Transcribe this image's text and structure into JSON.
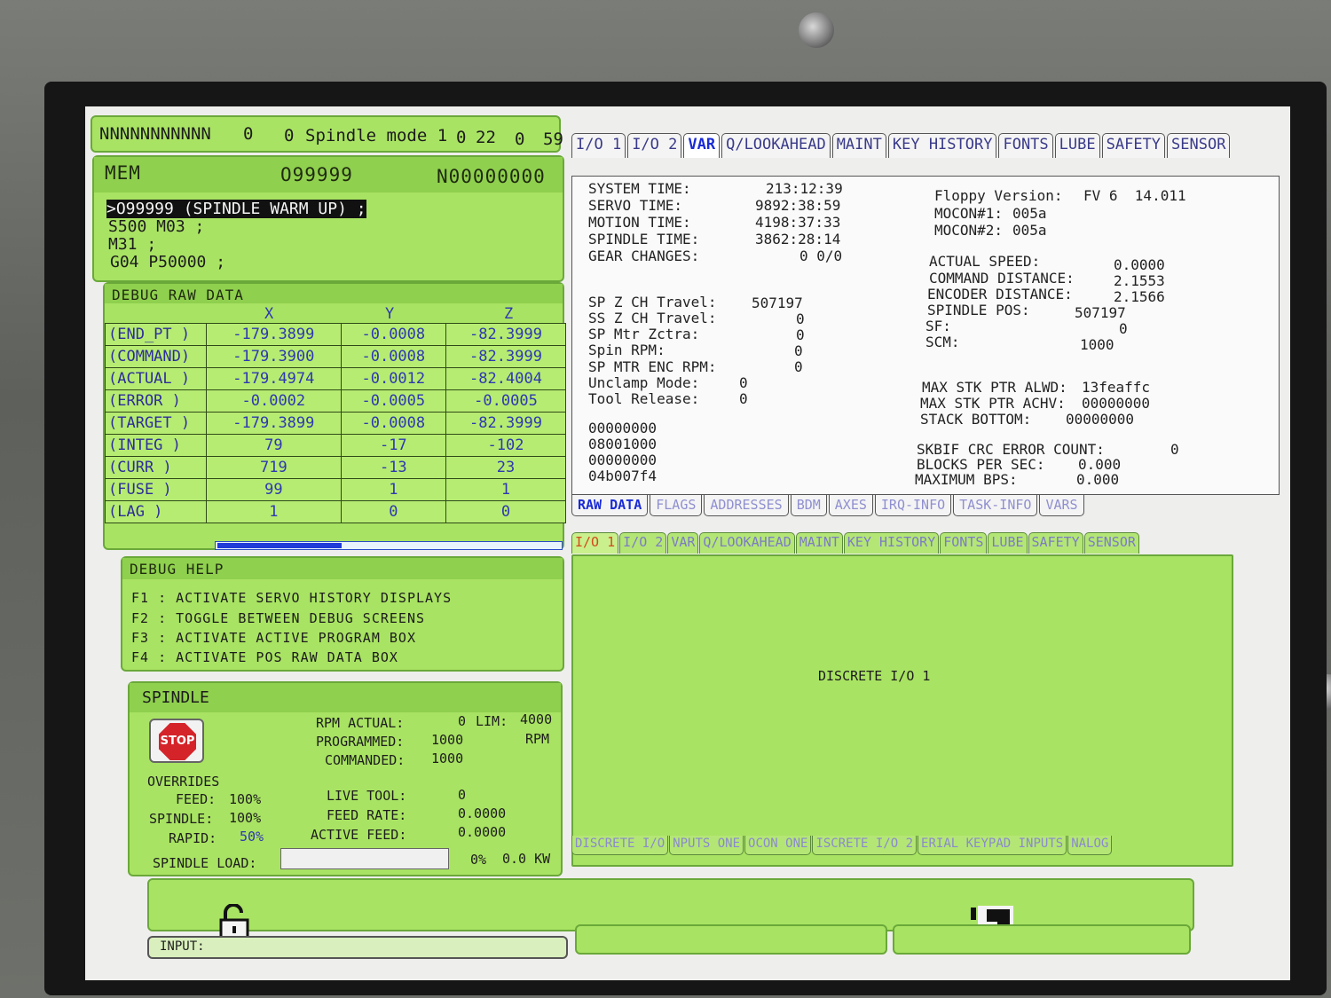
{
  "status": {
    "program_id": "NNNNNNNNNNN",
    "a": "0",
    "b": "0",
    "text": "Spindle mode 1",
    "c": "0",
    "d": "22",
    "e": "0",
    "f": "59"
  },
  "program": {
    "mode": "MEM",
    "number": "O99999",
    "block": "N00000000",
    "lines": [
      ">O99999 (SPINDLE WARM UP) ;",
      "S500 M03 ;",
      "M31 ;",
      "G04 P50000 ;"
    ]
  },
  "debug_raw": {
    "title": "DEBUG RAW DATA",
    "columns": [
      "X",
      "Y",
      "Z"
    ],
    "rows": [
      {
        "label": "(END_PT  )",
        "x": "-179.3899",
        "y": "-0.0008",
        "z": "-82.3999"
      },
      {
        "label": "(COMMAND)",
        "x": "-179.3900",
        "y": "-0.0008",
        "z": "-82.3999"
      },
      {
        "label": "(ACTUAL  )",
        "x": "-179.4974",
        "y": "-0.0012",
        "z": "-82.4004"
      },
      {
        "label": "(ERROR    )",
        "x": "-0.0002",
        "y": "-0.0005",
        "z": "-0.0005"
      },
      {
        "label": "(TARGET  )",
        "x": "-179.3899",
        "y": "-0.0008",
        "z": "-82.3999"
      },
      {
        "label": "(INTEG    )",
        "x": "79",
        "y": "-17",
        "z": "-102"
      },
      {
        "label": "(CURR     )",
        "x": "719",
        "y": "-13",
        "z": "23"
      },
      {
        "label": "(FUSE     )",
        "x": "99",
        "y": "1",
        "z": "1"
      },
      {
        "label": "(LAG      )",
        "x": "1",
        "y": "0",
        "z": "0"
      }
    ]
  },
  "debug_help": {
    "title": "DEBUG HELP",
    "lines": [
      "F1 : ACTIVATE SERVO HISTORY DISPLAYS",
      "F2 : TOGGLE BETWEEN DEBUG SCREENS",
      "F3 : ACTIVATE ACTIVE PROGRAM BOX",
      "F4 : ACTIVATE POS RAW DATA BOX"
    ]
  },
  "spindle": {
    "title": "SPINDLE",
    "stop_label": "STOP",
    "rpm_actual_label": "RPM ACTUAL:",
    "rpm_actual": "0",
    "lim_label": "LIM:",
    "lim": "4000",
    "programmed_label": "PROGRAMMED:",
    "programmed": "1000",
    "rpm_unit": "RPM",
    "commanded_label": "COMMANDED:",
    "commanded": "1000",
    "overrides_label": "OVERRIDES",
    "feed_label": "FEED:",
    "feed": "100%",
    "spindle_label": "SPINDLE:",
    "spindle_val": "100%",
    "rapid_label": "RAPID:",
    "rapid": "50%",
    "live_tool_label": "LIVE TOOL:",
    "live_tool": "0",
    "feed_rate_label": "FEED RATE:",
    "feed_rate": "0.0000",
    "active_feed_label": "ACTIVE FEED:",
    "active_feed": "0.0000",
    "load_label": "SPINDLE LOAD:",
    "load_pct": "0%",
    "load_kw": "0.0 KW"
  },
  "input_label": "INPUT:",
  "top_tabs": [
    "I/O 1",
    "I/O 2",
    "VAR",
    "Q/LOOKAHEAD",
    "MAINT",
    "KEY HISTORY",
    "FONTS",
    "LUBE",
    "SAFETY",
    "SENSOR"
  ],
  "var": {
    "system_time_label": "SYSTEM TIME:",
    "system_time": "213:12:39",
    "servo_time_label": "SERVO TIME:",
    "servo_time": "9892:38:59",
    "motion_time_label": "MOTION TIME:",
    "motion_time": "4198:37:33",
    "spindle_time_label": "SPINDLE TIME:",
    "spindle_time": "3862:28:14",
    "gear_changes_label": "GEAR CHANGES:",
    "gear_changes": "0 0/0",
    "floppy_label": "Floppy Version:",
    "floppy": "FV 6  14.011",
    "mocon1_label": "MOCON#1:",
    "mocon1": "005a",
    "mocon2_label": "MOCON#2:",
    "mocon2": "005a",
    "actual_speed_label": "ACTUAL SPEED:",
    "actual_speed": "0.0000",
    "command_distance_label": "COMMAND DISTANCE:",
    "command_distance": "2.1553",
    "encoder_distance_label": "ENCODER DISTANCE:",
    "encoder_distance": "2.1566",
    "spindle_pos_label": "SPINDLE POS:",
    "spindle_pos": "507197",
    "sf_label": "SF:",
    "sf": "0",
    "scm_label": "SCM:",
    "scm": "1000",
    "sp_z_ch_label": "SP Z CH Travel:",
    "sp_z_ch": "507197",
    "ss_z_ch_label": "SS Z CH Travel:",
    "ss_z_ch": "0",
    "sp_mtr_zctra_label": "SP Mtr Zctra:",
    "sp_mtr_zctra": "0",
    "spin_rpm_label": "Spin RPM:",
    "spin_rpm": "0",
    "sp_mtr_enc_label": "SP MTR ENC RPM:",
    "sp_mtr_enc": "0",
    "unclamp_label": "Unclamp Mode:",
    "unclamp": "0",
    "tool_release_label": "Tool Release:",
    "tool_release": "0",
    "max_stk_alwd_label": "MAX STK PTR ALWD:",
    "max_stk_alwd": "13feaffc",
    "max_stk_achv_label": "MAX STK PTR ACHV:",
    "max_stk_achv": "00000000",
    "stack_bottom_label": "STACK BOTTOM:",
    "stack_bottom": "00000000",
    "hex1": "00000000",
    "hex2": "08001000",
    "hex3": "00000000",
    "hex4": "04b007f4",
    "skbif_label": "SKBIF CRC ERROR COUNT:",
    "skbif": "0",
    "bps_label": "BLOCKS PER SEC:",
    "bps": "0.000",
    "max_bps_label": "MAXIMUM BPS:",
    "max_bps": "0.000"
  },
  "var_subtabs": [
    "RAW DATA",
    "FLAGS",
    "ADDRESSES",
    "BDM",
    "AXES",
    "IRQ-INFO",
    "TASK-INFO",
    "VARS"
  ],
  "io_tabs": [
    "I/O 1",
    "I/O 2",
    "VAR",
    "Q/LOOKAHEAD",
    "MAINT",
    "KEY HISTORY",
    "FONTS",
    "LUBE",
    "SAFETY",
    "SENSOR"
  ],
  "io_title": "DISCRETE I/O 1",
  "io_subtabs": [
    "DISCRETE I/O",
    "NPUTS ONE",
    "OCON ONE",
    "ISCRETE I/O 2",
    "ERIAL KEYPAD INPUTS",
    "NALOG"
  ],
  "colors": {
    "panel_green": "#a9e363",
    "header_green": "#8fd04e",
    "value_blue": "#2e38b0",
    "active_orange": "#d24b1a"
  }
}
